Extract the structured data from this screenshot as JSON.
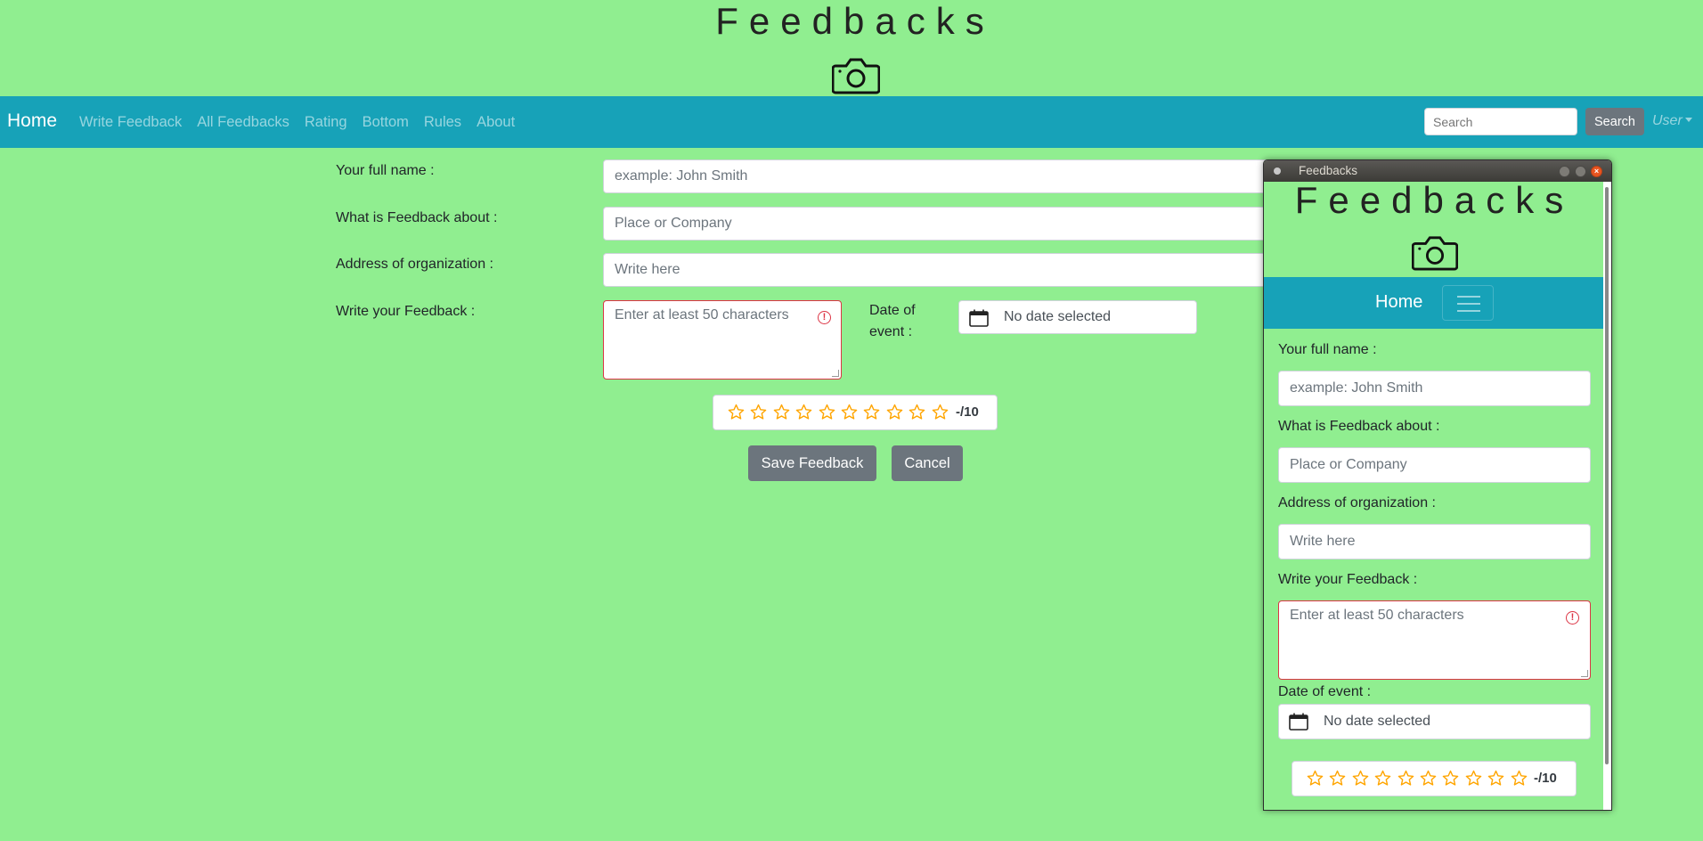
{
  "site": {
    "title": "Feedbacks",
    "camera_icon": "camera-icon"
  },
  "navbar": {
    "brand": "Home",
    "links": [
      "Write Feedback",
      "All Feedbacks",
      "Rating",
      "Bottom",
      "Rules",
      "About"
    ],
    "search_placeholder": "Search",
    "search_button": "Search",
    "user_menu": "User",
    "color": "#17a2b8"
  },
  "form": {
    "full_name_label": "Your full name :",
    "full_name_placeholder": "example: John Smith",
    "about_label": "What is Feedback about :",
    "about_placeholder": "Place or Company",
    "address_label": "Address of organization :",
    "address_placeholder": "Write here",
    "feedback_label": "Write your Feedback :",
    "feedback_placeholder": "Enter at least 50 characters",
    "date_label": "Date of event :",
    "date_label_line1": "Date of",
    "date_label_line2": "event :",
    "date_value": "No date selected",
    "rating_stars": 10,
    "rating_value": "-/10",
    "save_button": "Save Feedback",
    "cancel_button": "Cancel"
  },
  "window": {
    "title": "Feedbacks"
  },
  "colors": {
    "background": "#90ee90",
    "error": "#dc3545",
    "button": "#6c757d",
    "star": "#ffa500"
  }
}
